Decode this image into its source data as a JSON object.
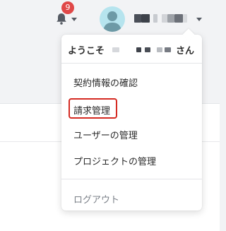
{
  "header": {
    "notification_count": "9",
    "icons": {
      "notifications": "bell-icon",
      "notifications_menu": "caret-down-icon",
      "avatar": "user-avatar-icon",
      "user_menu": "caret-down-icon"
    }
  },
  "user_menu": {
    "greeting_prefix": "ようこそ",
    "greeting_suffix": "さん",
    "items": [
      {
        "label": "契約情報の確認"
      },
      {
        "label": "請求管理",
        "highlighted": true
      },
      {
        "label": "ユーザーの管理"
      },
      {
        "label": "プロジェクトの管理"
      }
    ],
    "logout_label": "ログアウト"
  },
  "colors": {
    "badge": "#e04848",
    "highlight_border": "#d52a22",
    "avatar_background": "#b6e4ee",
    "avatar_figure": "#6d9aa6",
    "icon": "#555a63"
  }
}
